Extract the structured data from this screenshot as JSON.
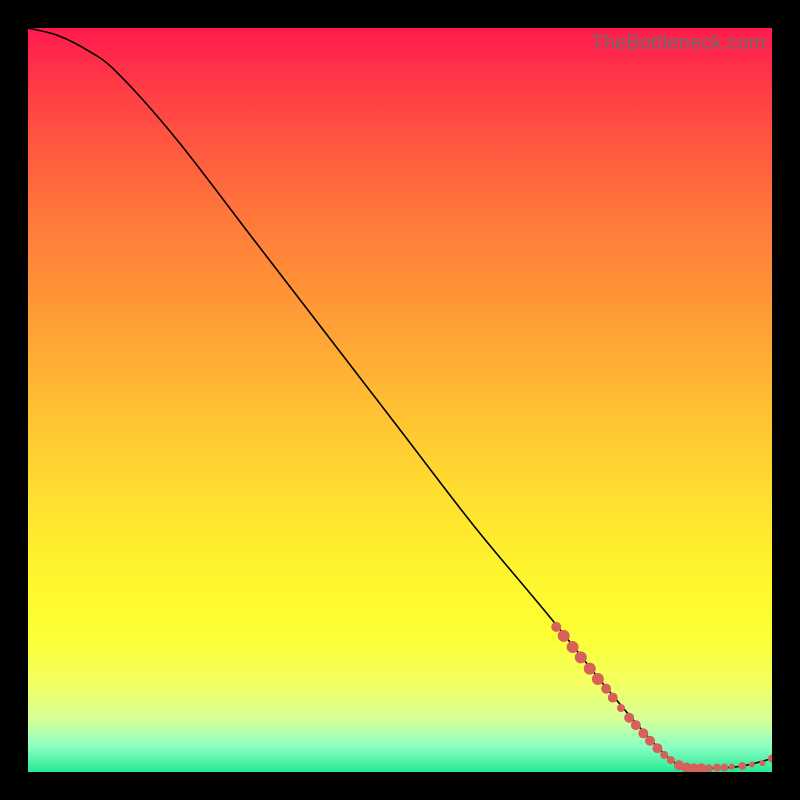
{
  "watermark": "TheBottleneck.com",
  "chart_data": {
    "type": "line",
    "title": "",
    "xlabel": "",
    "ylabel": "",
    "xlim": [
      0,
      100
    ],
    "ylim": [
      0,
      100
    ],
    "grid": false,
    "curve": [
      {
        "x": 0,
        "y": 100
      },
      {
        "x": 4,
        "y": 99
      },
      {
        "x": 8,
        "y": 97
      },
      {
        "x": 12,
        "y": 94
      },
      {
        "x": 20,
        "y": 85
      },
      {
        "x": 30,
        "y": 72
      },
      {
        "x": 40,
        "y": 59
      },
      {
        "x": 50,
        "y": 46
      },
      {
        "x": 60,
        "y": 33
      },
      {
        "x": 70,
        "y": 21
      },
      {
        "x": 78,
        "y": 11
      },
      {
        "x": 84,
        "y": 4
      },
      {
        "x": 87,
        "y": 1.2
      },
      {
        "x": 89,
        "y": 0.5
      },
      {
        "x": 92,
        "y": 0.5
      },
      {
        "x": 96,
        "y": 0.8
      },
      {
        "x": 100,
        "y": 1.8
      }
    ],
    "scatter": [
      {
        "x": 71.0,
        "y": 19.5,
        "r": 5
      },
      {
        "x": 72.0,
        "y": 18.3,
        "r": 6
      },
      {
        "x": 73.2,
        "y": 16.8,
        "r": 6
      },
      {
        "x": 74.3,
        "y": 15.4,
        "r": 6
      },
      {
        "x": 75.5,
        "y": 13.9,
        "r": 6
      },
      {
        "x": 76.6,
        "y": 12.5,
        "r": 6
      },
      {
        "x": 77.7,
        "y": 11.2,
        "r": 5
      },
      {
        "x": 78.6,
        "y": 10.0,
        "r": 5
      },
      {
        "x": 79.7,
        "y": 8.6,
        "r": 4
      },
      {
        "x": 80.8,
        "y": 7.3,
        "r": 5
      },
      {
        "x": 81.7,
        "y": 6.3,
        "r": 5
      },
      {
        "x": 82.7,
        "y": 5.2,
        "r": 5
      },
      {
        "x": 83.6,
        "y": 4.2,
        "r": 5
      },
      {
        "x": 84.6,
        "y": 3.2,
        "r": 5
      },
      {
        "x": 85.5,
        "y": 2.3,
        "r": 4
      },
      {
        "x": 86.4,
        "y": 1.6,
        "r": 4
      },
      {
        "x": 87.5,
        "y": 0.9,
        "r": 5
      },
      {
        "x": 88.5,
        "y": 0.6,
        "r": 5
      },
      {
        "x": 89.5,
        "y": 0.5,
        "r": 5
      },
      {
        "x": 90.5,
        "y": 0.5,
        "r": 5
      },
      {
        "x": 91.5,
        "y": 0.5,
        "r": 4
      },
      {
        "x": 92.6,
        "y": 0.6,
        "r": 4
      },
      {
        "x": 93.6,
        "y": 0.6,
        "r": 4
      },
      {
        "x": 94.6,
        "y": 0.7,
        "r": 3
      },
      {
        "x": 96.0,
        "y": 0.8,
        "r": 4
      },
      {
        "x": 97.3,
        "y": 1.0,
        "r": 3
      },
      {
        "x": 98.7,
        "y": 1.2,
        "r": 3
      },
      {
        "x": 100.0,
        "y": 1.8,
        "r": 4
      }
    ]
  }
}
